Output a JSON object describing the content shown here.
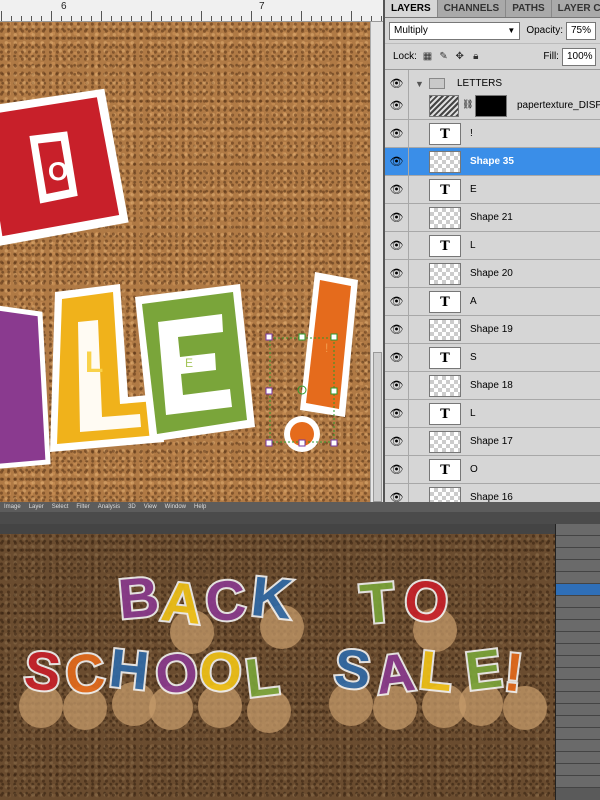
{
  "ruler": {
    "marks": [
      "6",
      "7"
    ]
  },
  "panel": {
    "tabs": [
      "LAYERS",
      "CHANNELS",
      "PATHS",
      "LAYER CO"
    ],
    "blend_mode": "Multiply",
    "opacity_label": "Opacity:",
    "opacity_value": "75%",
    "lock_label": "Lock:",
    "fill_label": "Fill:",
    "fill_value": "100%",
    "group_name": "LETTERS",
    "layers": [
      {
        "name": "papertexture_DISP",
        "kind": "image",
        "selected": false
      },
      {
        "name": "!",
        "kind": "text",
        "selected": false
      },
      {
        "name": "Shape 35",
        "kind": "shape",
        "selected": true
      },
      {
        "name": "E",
        "kind": "text",
        "selected": false
      },
      {
        "name": "Shape 21",
        "kind": "shape",
        "selected": false
      },
      {
        "name": "L",
        "kind": "text",
        "selected": false
      },
      {
        "name": "Shape 20",
        "kind": "shape",
        "selected": false
      },
      {
        "name": "A",
        "kind": "text",
        "selected": false
      },
      {
        "name": "Shape 19",
        "kind": "shape",
        "selected": false
      },
      {
        "name": "S",
        "kind": "text",
        "selected": false
      },
      {
        "name": "Shape 18",
        "kind": "shape",
        "selected": false
      },
      {
        "name": "L",
        "kind": "text",
        "selected": false
      },
      {
        "name": "Shape 17",
        "kind": "shape",
        "selected": false
      },
      {
        "name": "O",
        "kind": "text",
        "selected": false
      },
      {
        "name": "Shape 16",
        "kind": "shape",
        "selected": false
      }
    ],
    "text_thumb_glyph": "T"
  },
  "preview": {
    "menu": [
      "Image",
      "Layer",
      "Select",
      "Filter",
      "Analysis",
      "3D",
      "View",
      "Window",
      "Help"
    ],
    "line1": [
      "B",
      "A",
      "C",
      "K",
      "T",
      "O"
    ],
    "line2": [
      "S",
      "C",
      "H",
      "O",
      "O",
      "L",
      "S",
      "A",
      "L",
      "E",
      "!"
    ],
    "colors": {
      "red": "#c8202a",
      "purple": "#8a3a8f",
      "green": "#7aa53a",
      "blue": "#2f6aa8",
      "orange": "#e56b1c",
      "yellow": "#f2c417",
      "selection": "#3a8ee8"
    }
  },
  "canvas_letters": [
    {
      "char": "O",
      "color": "#c8202a"
    },
    {
      "char": "L",
      "color": "#f0b21b"
    },
    {
      "char": "E",
      "color": "#7aa53a"
    },
    {
      "char": "!",
      "color": "#e56b1c"
    }
  ]
}
